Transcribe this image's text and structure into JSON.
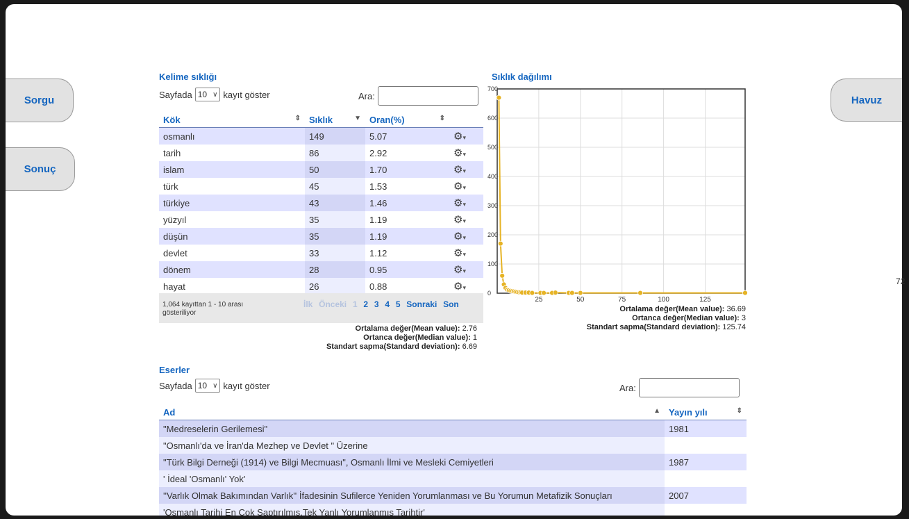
{
  "nav": {
    "sorgu": "Sorgu",
    "sonuc": "Sonuç",
    "havuz": "Havuz"
  },
  "freq_table": {
    "title": "Kelime sıklığı",
    "page_size_prefix": "Sayfada",
    "page_size_value": "10",
    "page_size_suffix": "kayıt göster",
    "search_label": "Ara:",
    "columns": [
      "Kök",
      "Sıklık",
      "Oran(%)"
    ],
    "rows": [
      {
        "kok": "osmanlı",
        "siklik": "149",
        "oran": "5.07"
      },
      {
        "kok": "tarih",
        "siklik": "86",
        "oran": "2.92"
      },
      {
        "kok": "islam",
        "siklik": "50",
        "oran": "1.70"
      },
      {
        "kok": "türk",
        "siklik": "45",
        "oran": "1.53"
      },
      {
        "kok": "türkiye",
        "siklik": "43",
        "oran": "1.46"
      },
      {
        "kok": "yüzyıl",
        "siklik": "35",
        "oran": "1.19"
      },
      {
        "kok": "düşün",
        "siklik": "35",
        "oran": "1.19"
      },
      {
        "kok": "devlet",
        "siklik": "33",
        "oran": "1.12"
      },
      {
        "kok": "dönem",
        "siklik": "28",
        "oran": "0.95"
      },
      {
        "kok": "hayat",
        "siklik": "26",
        "oran": "0.88"
      }
    ],
    "info": "1,064 kayıttan 1 - 10 arası gösteriliyor",
    "pager": {
      "first": "İlk",
      "prev": "Önceki",
      "pages": [
        "1",
        "2",
        "3",
        "4",
        "5"
      ],
      "next": "Sonraki",
      "last": "Son"
    },
    "stats": {
      "mean_label": "Ortalama değer(Mean value):",
      "mean_value": "2.76",
      "median_label": "Ortanca değer(Median value):",
      "median_value": "1",
      "std_label": "Standart sapma(Standard deviation):",
      "std_value": "6.69"
    }
  },
  "distribution": {
    "title": "Sıklık dağılımı",
    "stats": {
      "mean_label": "Ortalama değer(Mean value):",
      "mean_value": "36.69",
      "median_label": "Ortanca değer(Median value):",
      "median_value": "3",
      "std_label": "Standart sapma(Standard deviation):",
      "std_value": "125.74"
    }
  },
  "chart_data": {
    "type": "line",
    "title": "",
    "xlabel": "",
    "ylabel": "",
    "x_ticks": [
      25,
      50,
      75,
      100,
      125
    ],
    "y_ticks": [
      0,
      100,
      200,
      300,
      400,
      500,
      600,
      700
    ],
    "xlim": [
      0,
      149
    ],
    "ylim": [
      0,
      700
    ],
    "grid": true,
    "color": "#e6b325",
    "series": [
      {
        "x": [
          1,
          2,
          3,
          4,
          5,
          6,
          7,
          8,
          9,
          10,
          11,
          12,
          13,
          14,
          15,
          17,
          19,
          21,
          26,
          28,
          33,
          35,
          43,
          45,
          50,
          86,
          149
        ],
        "y": [
          670,
          170,
          60,
          30,
          18,
          12,
          10,
          8,
          7,
          6,
          5,
          4,
          3,
          3,
          2,
          2,
          2,
          1,
          1,
          1,
          1,
          2,
          1,
          1,
          1,
          1,
          1
        ]
      }
    ]
  },
  "works_table": {
    "title": "Eserler",
    "page_size_prefix": "Sayfada",
    "page_size_value": "10",
    "page_size_suffix": "kayıt göster",
    "search_label": "Ara:",
    "columns": [
      "Ad",
      "Yayın yılı"
    ],
    "rows": [
      {
        "ad": "\"Medreselerin Gerilemesi\"",
        "yil": "1981"
      },
      {
        "ad": "\"Osmanlı'da ve İran'da Mezhep ve Devlet \" Üzerine",
        "yil": ""
      },
      {
        "ad": "\"Türk Bilgi Derneği (1914) ve Bilgi Mecmuası\", Osmanlı İlmi ve Mesleki Cemiyetleri",
        "yil": "1987"
      },
      {
        "ad": "' İdeal 'Osmanlı' Yok'",
        "yil": ""
      },
      {
        "ad": "''Varlık Olmak Bakımından Varlık'' İfadesinin Sufilerce Yeniden Yorumlanması ve Bu Yorumun Metafizik Sonuçları",
        "yil": "2007"
      },
      {
        "ad": "'Osmanlı Tarihi En Çok Saptırılmış,Tek Yanlı Yorumlanmış Tarihtir'",
        "yil": ""
      }
    ]
  },
  "edge_fragment": "72"
}
